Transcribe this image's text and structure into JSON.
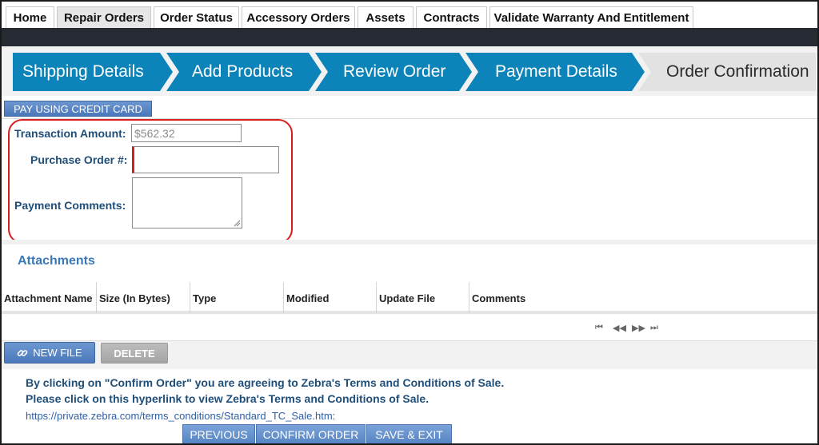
{
  "tabs": [
    {
      "label": "Home"
    },
    {
      "label": "Repair Orders"
    },
    {
      "label": "Order Status"
    },
    {
      "label": "Accessory Orders"
    },
    {
      "label": "Assets"
    },
    {
      "label": "Contracts"
    },
    {
      "label": "Validate Warranty And Entitlement"
    }
  ],
  "active_tab": "Repair Orders",
  "steps": [
    {
      "label": "Shipping Details"
    },
    {
      "label": "Add Products"
    },
    {
      "label": "Review Order"
    },
    {
      "label": "Payment Details"
    },
    {
      "label": "Order Confirmation"
    }
  ],
  "colors": {
    "step_done": "#0d84b9",
    "step_pending": "#e2e2e2",
    "highlight": "#d61e1e",
    "label": "#1f4e79"
  },
  "pay_button": {
    "label": "PAY USING CREDIT CARD"
  },
  "form": {
    "transaction_amount": {
      "label": "Transaction Amount:",
      "value": "$562.32"
    },
    "purchase_order": {
      "label": "Purchase Order #:",
      "value": ""
    },
    "payment_comments": {
      "label": "Payment Comments:",
      "value": ""
    }
  },
  "attachments": {
    "title": "Attachments",
    "columns": [
      "Attachment Name",
      "Size (In Bytes)",
      "Type",
      "Modified",
      "Update File",
      "Comments"
    ],
    "pager": {
      "first": "⏮",
      "prev": "◀◀",
      "next": "▶▶",
      "last": "⏭"
    },
    "new_file_label": "NEW FILE",
    "delete_label": "DELETE"
  },
  "terms": {
    "line1": "By clicking on \"Confirm Order\" you are agreeing to Zebra's Terms and Conditions of Sale.",
    "line2": "Please click on this hyperlink to view Zebra's Terms and Conditions of Sale.",
    "link": "https://private.zebra.com/terms_conditions/Standard_TC_Sale.htm:"
  },
  "actions": {
    "previous": "PREVIOUS",
    "confirm": "CONFIRM ORDER",
    "save_exit": "SAVE & EXIT"
  }
}
